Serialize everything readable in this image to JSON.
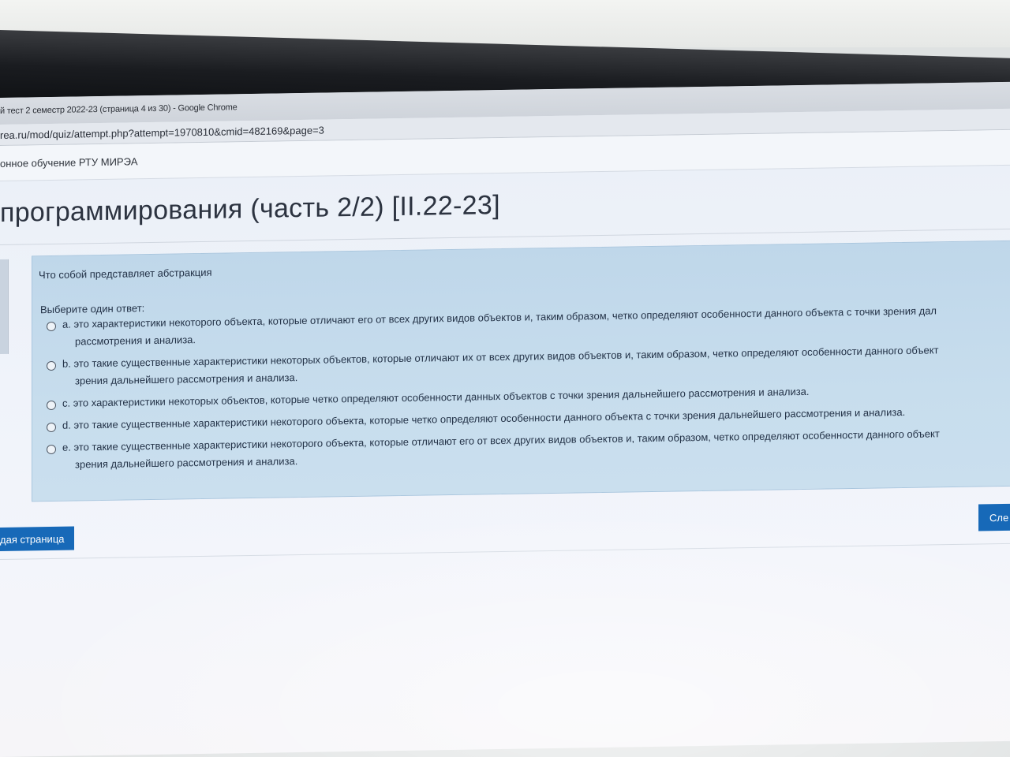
{
  "browser": {
    "window_title": "й тест 2 семестр 2022-23 (страница 4 из 30) - Google Chrome",
    "url": "rea.ru/mod/quiz/attempt.php?attempt=1970810&cmid=482169&page=3"
  },
  "site": {
    "name": "онное обучение РТУ МИРЭА"
  },
  "page": {
    "title": "программирования (часть 2/2) [II.22-23]"
  },
  "question": {
    "text": "Что собой представляет абстракция",
    "prompt": "Выберите один ответ:",
    "answers": [
      {
        "label": "a. это характеристики некоторого объекта, которые отличают его от всех других видов объектов и, таким образом, четко определяют особенности данного объекта с точки зрения дал",
        "line2": "рассмотрения и анализа."
      },
      {
        "label": "b. это такие существенные характеристики некоторых объектов, которые отличают их от всех других видов объектов и, таким образом, четко определяют особенности данного объект",
        "line2": "зрения дальнейшего рассмотрения и анализа."
      },
      {
        "label": "c. это характеристики некоторых объектов, которые четко определяют особенности данных объектов с точки зрения дальнейшего рассмотрения и анализа.",
        "line2": ""
      },
      {
        "label": "d. это такие существенные характеристики некоторого объекта, которые четко определяют особенности данного объекта с точки зрения дальнейшего рассмотрения и анализа.",
        "line2": ""
      },
      {
        "label": "e. это такие существенные характеристики некоторого объекта, которые отличают его от всех других видов объектов и, таким образом, четко определяют особенности данного объект",
        "line2": "зрения дальнейшего рассмотрения и анализа."
      }
    ]
  },
  "navigation": {
    "prev_label": "дая страница",
    "next_label": "Сле"
  },
  "colors": {
    "accent": "#1769b8",
    "question_bg": "#c7dded"
  }
}
